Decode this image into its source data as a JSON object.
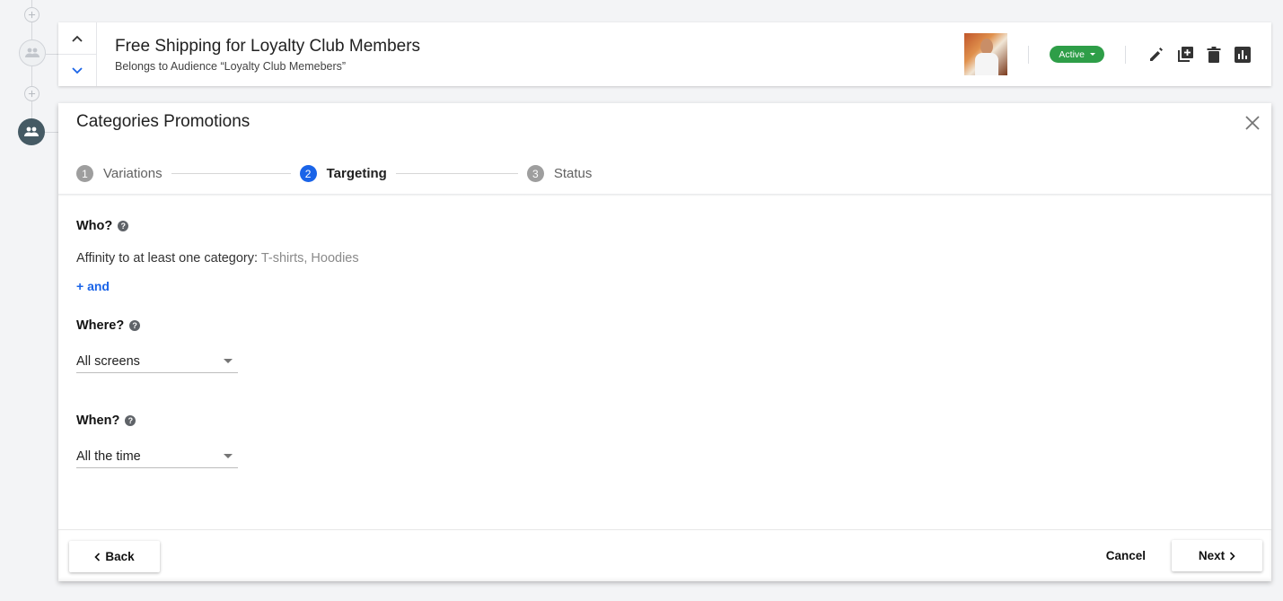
{
  "audience_card": {
    "title": "Free Shipping for Loyalty Club Members",
    "subtitle": "Belongs to Audience “Loyalty Club Memebers”",
    "status": "Active",
    "status_color": "#2e9e48"
  },
  "editor": {
    "title": "Categories Promotions",
    "steps": [
      {
        "num": "1",
        "label": "Variations",
        "state": "done"
      },
      {
        "num": "2",
        "label": "Targeting",
        "state": "current"
      },
      {
        "num": "3",
        "label": "Status",
        "state": "upcoming"
      }
    ],
    "who": {
      "label": "Who?",
      "condition_prefix": "Affinity to at least one category:",
      "condition_values": "T-shirts, Hoodies",
      "add_link": "+ and"
    },
    "where": {
      "label": "Where?",
      "selected": "All screens"
    },
    "when": {
      "label": "When?",
      "selected": "All the time"
    },
    "footer": {
      "back": "Back",
      "cancel": "Cancel",
      "next": "Next"
    }
  },
  "colors": {
    "accent": "#1a64e8",
    "timeline_active": "#455a64"
  },
  "icons": [
    "plus-icon",
    "people-icon",
    "chevron-up-icon",
    "chevron-down-icon",
    "edit-icon",
    "duplicate-icon",
    "delete-icon",
    "analytics-icon",
    "close-icon",
    "help-icon",
    "caret-down-icon",
    "chevron-left-icon",
    "chevron-right-icon"
  ]
}
